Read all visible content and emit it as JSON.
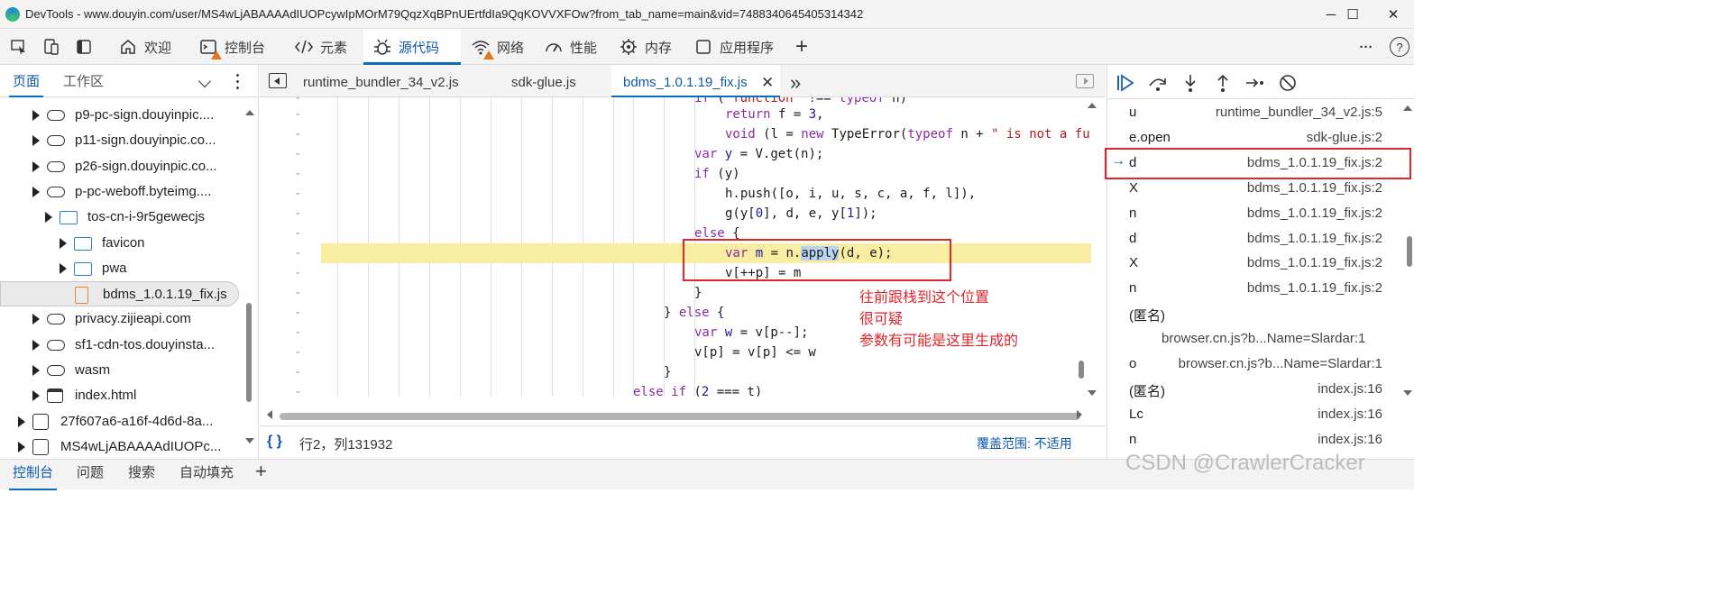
{
  "window": {
    "title": "DevTools - www.douyin.com/user/MS4wLjABAAAAdIUOPcywIpMOrM79QqzXqBPnUErtfdIa9QqKOVVXFOw?from_tab_name=main&vid=7488340645405314342",
    "controls": [
      "─",
      "☐",
      "✕"
    ]
  },
  "toolbar": {
    "tabs": [
      {
        "label": "欢迎",
        "icon": "home-icon"
      },
      {
        "label": "控制台",
        "icon": "console-icon"
      },
      {
        "label": "元素",
        "icon": "code-brackets-icon"
      },
      {
        "label": "源代码",
        "icon": "bug-icon"
      },
      {
        "label": "网络",
        "icon": "wifi-icon"
      },
      {
        "label": "性能",
        "icon": "performance-icon"
      },
      {
        "label": "内存",
        "icon": "memory-icon"
      },
      {
        "label": "应用程序",
        "icon": "application-icon"
      }
    ],
    "add": "+",
    "more": "···",
    "help": "?"
  },
  "left_panel": {
    "tabs": [
      "页面",
      "工作区"
    ],
    "tree": [
      {
        "label": "p9-pc-sign.douyinpic....",
        "icon": "cloud",
        "indent": 1
      },
      {
        "label": "p11-sign.douyinpic.co...",
        "icon": "cloud",
        "indent": 1
      },
      {
        "label": "p26-sign.douyinpic.co...",
        "icon": "cloud",
        "indent": 1
      },
      {
        "label": "p-pc-weboff.byteimg....",
        "icon": "cloud",
        "indent": 1
      },
      {
        "label": "tos-cn-i-9r5gewecjs",
        "icon": "folder",
        "indent": 2
      },
      {
        "label": "favicon",
        "icon": "folder",
        "indent": 3
      },
      {
        "label": "pwa",
        "icon": "folder",
        "indent": 3
      },
      {
        "label": "bdms_1.0.1.19_fix.js",
        "icon": "file",
        "indent": 3,
        "selected": true
      },
      {
        "label": "privacy.zijieapi.com",
        "icon": "cloud",
        "indent": 1
      },
      {
        "label": "sf1-cdn-tos.douyinsta...",
        "icon": "cloud",
        "indent": 1
      },
      {
        "label": "wasm",
        "icon": "cloud",
        "indent": 1
      },
      {
        "label": "index.html",
        "icon": "window",
        "indent": 1
      },
      {
        "label": "27f607a6-a16f-4d6d-8a...",
        "icon": "gear",
        "indent": 0
      },
      {
        "label": "MS4wLjABAAAAdIUOPc...",
        "icon": "gear",
        "indent": 0
      }
    ]
  },
  "editor": {
    "tabs": [
      "runtime_bundler_34_v2.js",
      "sdk-glue.js",
      "bdms_1.0.1.19_fix.js"
    ],
    "overflow": "»",
    "status": {
      "braces": "{ }",
      "position": "行2，列131932",
      "coverage": "覆盖范围: 不适用"
    }
  },
  "call_stack": [
    {
      "fn": "u",
      "loc": "runtime_bundler_34_v2.js:5"
    },
    {
      "fn": "e.open",
      "loc": "sdk-glue.js:2"
    },
    {
      "fn": "d",
      "loc": "bdms_1.0.1.19_fix.js:2",
      "current": true
    },
    {
      "fn": "X",
      "loc": "bdms_1.0.1.19_fix.js:2"
    },
    {
      "fn": "n",
      "loc": "bdms_1.0.1.19_fix.js:2"
    },
    {
      "fn": "d",
      "loc": "bdms_1.0.1.19_fix.js:2"
    },
    {
      "fn": "X",
      "loc": "bdms_1.0.1.19_fix.js:2"
    },
    {
      "fn": "n",
      "loc": "bdms_1.0.1.19_fix.js:2"
    },
    {
      "fn": "(匿名)",
      "loc": ""
    },
    {
      "fn": "",
      "loc": "browser.cn.js?b...Name=Slardar:1",
      "sub": true
    },
    {
      "fn": "o",
      "loc": "browser.cn.js?b...Name=Slardar:1"
    },
    {
      "fn": "(匿名)",
      "loc": "index.js:16"
    },
    {
      "fn": "Lc",
      "loc": "index.js:16"
    },
    {
      "fn": "n",
      "loc": "index.js:16"
    }
  ],
  "bottom_tabs": [
    "控制台",
    "问题",
    "搜索",
    "自动填充"
  ],
  "annotation": [
    "往前跟栈到这个位置",
    "很可疑",
    "参数有可能是这里生成的"
  ],
  "watermark": "CSDN @CrawlerCracker"
}
